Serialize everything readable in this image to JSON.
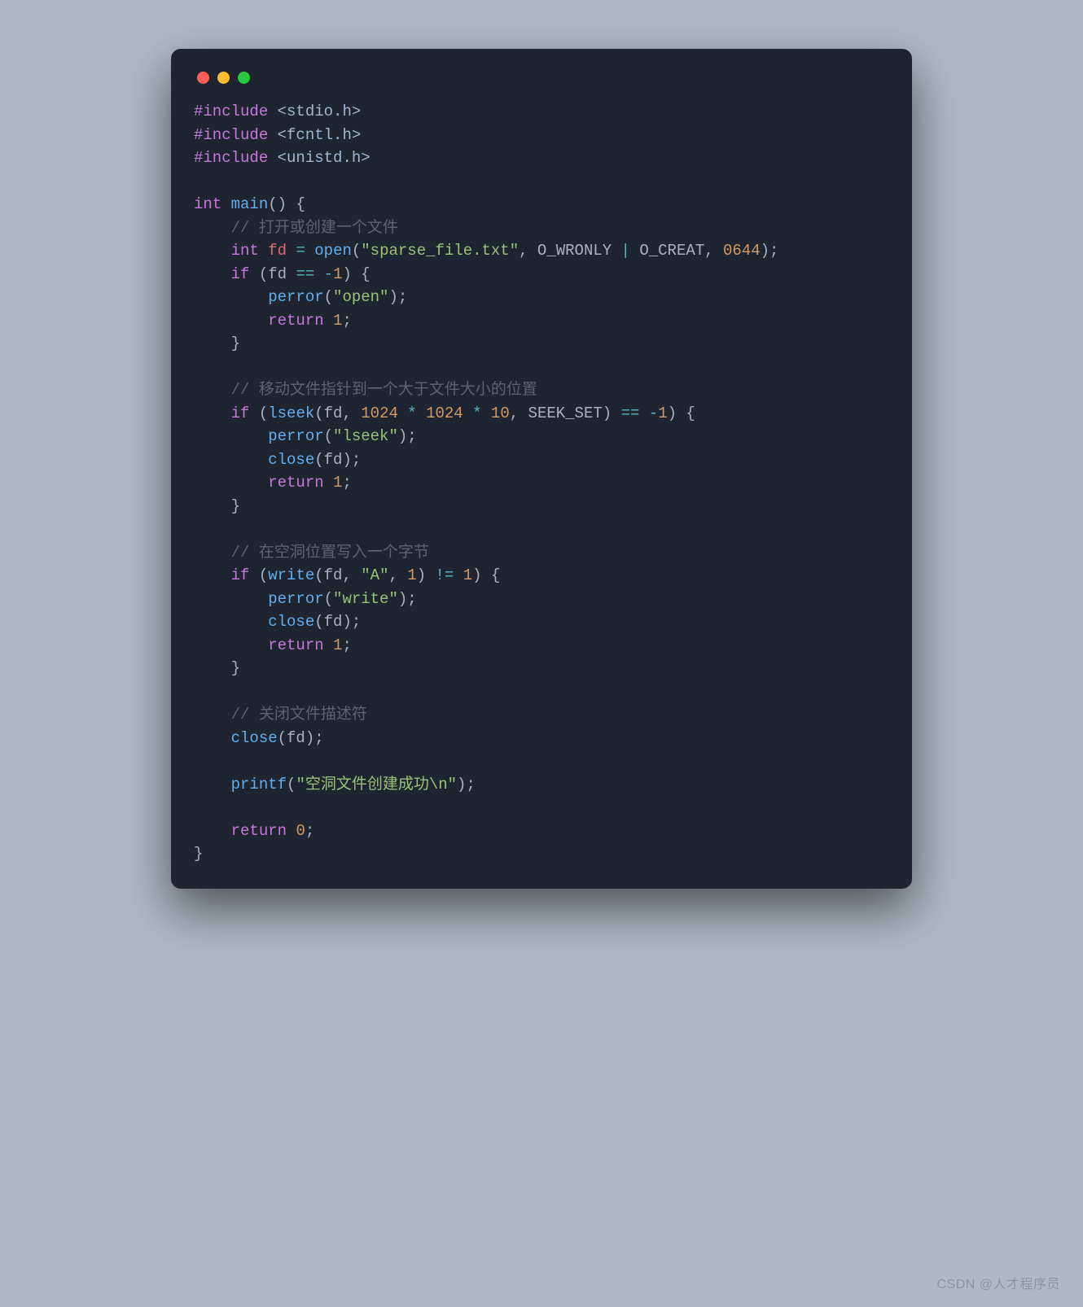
{
  "window": {
    "traffic_lights": [
      "red",
      "yellow",
      "green"
    ]
  },
  "code": {
    "lines": [
      [
        {
          "cls": "c-pre",
          "t": "#include"
        },
        {
          "cls": "c-punct",
          "t": " "
        },
        {
          "cls": "c-inc",
          "t": "<stdio.h>"
        }
      ],
      [
        {
          "cls": "c-pre",
          "t": "#include"
        },
        {
          "cls": "c-punct",
          "t": " "
        },
        {
          "cls": "c-inc",
          "t": "<fcntl.h>"
        }
      ],
      [
        {
          "cls": "c-pre",
          "t": "#include"
        },
        {
          "cls": "c-punct",
          "t": " "
        },
        {
          "cls": "c-inc",
          "t": "<unistd.h>"
        }
      ],
      [],
      [
        {
          "cls": "c-kw",
          "t": "int"
        },
        {
          "cls": "c-punct",
          "t": " "
        },
        {
          "cls": "c-fn",
          "t": "main"
        },
        {
          "cls": "c-punct",
          "t": "() {"
        }
      ],
      [
        {
          "cls": "c-punct",
          "t": "    "
        },
        {
          "cls": "c-cmt",
          "t": "// 打开或创建一个文件"
        }
      ],
      [
        {
          "cls": "c-punct",
          "t": "    "
        },
        {
          "cls": "c-kw",
          "t": "int"
        },
        {
          "cls": "c-punct",
          "t": " "
        },
        {
          "cls": "c-ident",
          "t": "fd"
        },
        {
          "cls": "c-punct",
          "t": " "
        },
        {
          "cls": "c-op",
          "t": "="
        },
        {
          "cls": "c-punct",
          "t": " "
        },
        {
          "cls": "c-fn",
          "t": "open"
        },
        {
          "cls": "c-punct",
          "t": "("
        },
        {
          "cls": "c-str",
          "t": "\"sparse_file.txt\""
        },
        {
          "cls": "c-punct",
          "t": ", O_WRONLY "
        },
        {
          "cls": "c-op",
          "t": "|"
        },
        {
          "cls": "c-punct",
          "t": " O_CREAT, "
        },
        {
          "cls": "c-num",
          "t": "0644"
        },
        {
          "cls": "c-punct",
          "t": ");"
        }
      ],
      [
        {
          "cls": "c-punct",
          "t": "    "
        },
        {
          "cls": "c-kw",
          "t": "if"
        },
        {
          "cls": "c-punct",
          "t": " (fd "
        },
        {
          "cls": "c-op",
          "t": "=="
        },
        {
          "cls": "c-punct",
          "t": " "
        },
        {
          "cls": "c-op",
          "t": "-"
        },
        {
          "cls": "c-num",
          "t": "1"
        },
        {
          "cls": "c-punct",
          "t": ") {"
        }
      ],
      [
        {
          "cls": "c-punct",
          "t": "        "
        },
        {
          "cls": "c-fn",
          "t": "perror"
        },
        {
          "cls": "c-punct",
          "t": "("
        },
        {
          "cls": "c-str",
          "t": "\"open\""
        },
        {
          "cls": "c-punct",
          "t": ");"
        }
      ],
      [
        {
          "cls": "c-punct",
          "t": "        "
        },
        {
          "cls": "c-kw",
          "t": "return"
        },
        {
          "cls": "c-punct",
          "t": " "
        },
        {
          "cls": "c-num",
          "t": "1"
        },
        {
          "cls": "c-punct",
          "t": ";"
        }
      ],
      [
        {
          "cls": "c-punct",
          "t": "    }"
        }
      ],
      [],
      [
        {
          "cls": "c-punct",
          "t": "    "
        },
        {
          "cls": "c-cmt",
          "t": "// 移动文件指针到一个大于文件大小的位置"
        }
      ],
      [
        {
          "cls": "c-punct",
          "t": "    "
        },
        {
          "cls": "c-kw",
          "t": "if"
        },
        {
          "cls": "c-punct",
          "t": " ("
        },
        {
          "cls": "c-fn",
          "t": "lseek"
        },
        {
          "cls": "c-punct",
          "t": "(fd, "
        },
        {
          "cls": "c-num",
          "t": "1024"
        },
        {
          "cls": "c-punct",
          "t": " "
        },
        {
          "cls": "c-op",
          "t": "*"
        },
        {
          "cls": "c-punct",
          "t": " "
        },
        {
          "cls": "c-num",
          "t": "1024"
        },
        {
          "cls": "c-punct",
          "t": " "
        },
        {
          "cls": "c-op",
          "t": "*"
        },
        {
          "cls": "c-punct",
          "t": " "
        },
        {
          "cls": "c-num",
          "t": "10"
        },
        {
          "cls": "c-punct",
          "t": ", SEEK_SET) "
        },
        {
          "cls": "c-op",
          "t": "=="
        },
        {
          "cls": "c-punct",
          "t": " "
        },
        {
          "cls": "c-op",
          "t": "-"
        },
        {
          "cls": "c-num",
          "t": "1"
        },
        {
          "cls": "c-punct",
          "t": ") {"
        }
      ],
      [
        {
          "cls": "c-punct",
          "t": "        "
        },
        {
          "cls": "c-fn",
          "t": "perror"
        },
        {
          "cls": "c-punct",
          "t": "("
        },
        {
          "cls": "c-str",
          "t": "\"lseek\""
        },
        {
          "cls": "c-punct",
          "t": ");"
        }
      ],
      [
        {
          "cls": "c-punct",
          "t": "        "
        },
        {
          "cls": "c-fn",
          "t": "close"
        },
        {
          "cls": "c-punct",
          "t": "(fd);"
        }
      ],
      [
        {
          "cls": "c-punct",
          "t": "        "
        },
        {
          "cls": "c-kw",
          "t": "return"
        },
        {
          "cls": "c-punct",
          "t": " "
        },
        {
          "cls": "c-num",
          "t": "1"
        },
        {
          "cls": "c-punct",
          "t": ";"
        }
      ],
      [
        {
          "cls": "c-punct",
          "t": "    }"
        }
      ],
      [],
      [
        {
          "cls": "c-punct",
          "t": "    "
        },
        {
          "cls": "c-cmt",
          "t": "// 在空洞位置写入一个字节"
        }
      ],
      [
        {
          "cls": "c-punct",
          "t": "    "
        },
        {
          "cls": "c-kw",
          "t": "if"
        },
        {
          "cls": "c-punct",
          "t": " ("
        },
        {
          "cls": "c-fn",
          "t": "write"
        },
        {
          "cls": "c-punct",
          "t": "(fd, "
        },
        {
          "cls": "c-str",
          "t": "\"A\""
        },
        {
          "cls": "c-punct",
          "t": ", "
        },
        {
          "cls": "c-num",
          "t": "1"
        },
        {
          "cls": "c-punct",
          "t": ") "
        },
        {
          "cls": "c-op",
          "t": "!="
        },
        {
          "cls": "c-punct",
          "t": " "
        },
        {
          "cls": "c-num",
          "t": "1"
        },
        {
          "cls": "c-punct",
          "t": ") {"
        }
      ],
      [
        {
          "cls": "c-punct",
          "t": "        "
        },
        {
          "cls": "c-fn",
          "t": "perror"
        },
        {
          "cls": "c-punct",
          "t": "("
        },
        {
          "cls": "c-str",
          "t": "\"write\""
        },
        {
          "cls": "c-punct",
          "t": ");"
        }
      ],
      [
        {
          "cls": "c-punct",
          "t": "        "
        },
        {
          "cls": "c-fn",
          "t": "close"
        },
        {
          "cls": "c-punct",
          "t": "(fd);"
        }
      ],
      [
        {
          "cls": "c-punct",
          "t": "        "
        },
        {
          "cls": "c-kw",
          "t": "return"
        },
        {
          "cls": "c-punct",
          "t": " "
        },
        {
          "cls": "c-num",
          "t": "1"
        },
        {
          "cls": "c-punct",
          "t": ";"
        }
      ],
      [
        {
          "cls": "c-punct",
          "t": "    }"
        }
      ],
      [],
      [
        {
          "cls": "c-punct",
          "t": "    "
        },
        {
          "cls": "c-cmt",
          "t": "// 关闭文件描述符"
        }
      ],
      [
        {
          "cls": "c-punct",
          "t": "    "
        },
        {
          "cls": "c-fn",
          "t": "close"
        },
        {
          "cls": "c-punct",
          "t": "(fd);"
        }
      ],
      [],
      [
        {
          "cls": "c-punct",
          "t": "    "
        },
        {
          "cls": "c-fn",
          "t": "printf"
        },
        {
          "cls": "c-punct",
          "t": "("
        },
        {
          "cls": "c-str",
          "t": "\"空洞文件创建成功\\n\""
        },
        {
          "cls": "c-punct",
          "t": ");"
        }
      ],
      [],
      [
        {
          "cls": "c-punct",
          "t": "    "
        },
        {
          "cls": "c-kw",
          "t": "return"
        },
        {
          "cls": "c-punct",
          "t": " "
        },
        {
          "cls": "c-num",
          "t": "0"
        },
        {
          "cls": "c-punct",
          "t": ";"
        }
      ],
      [
        {
          "cls": "c-punct",
          "t": "}"
        }
      ]
    ]
  },
  "watermark": "CSDN @人才程序员"
}
